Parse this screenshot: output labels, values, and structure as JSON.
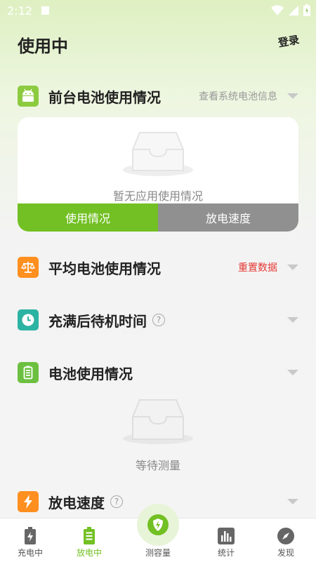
{
  "status_bar": {
    "time": "2:12"
  },
  "header": {
    "title": "使用中",
    "login_label": "登录"
  },
  "foreground_section": {
    "title": "前台电池使用情况",
    "link": "查看系统电池信息",
    "empty_text": "暂无应用使用情况",
    "tabs": [
      {
        "label": "使用情况",
        "active": true
      },
      {
        "label": "放电速度",
        "active": false
      }
    ]
  },
  "average_section": {
    "title": "平均电池使用情况",
    "reset_label": "重置数据"
  },
  "standby_section": {
    "title": "充满后待机时间",
    "help": "?"
  },
  "battery_usage_section": {
    "title": "电池使用情况",
    "empty_text": "等待测量"
  },
  "discharge_section": {
    "title": "放电速度",
    "help": "?"
  },
  "bottom_nav": {
    "items": [
      {
        "label": "充电中",
        "icon": "battery-charging-icon",
        "active": false
      },
      {
        "label": "放电中",
        "icon": "battery-discharging-icon",
        "active": true
      },
      {
        "label": "测容量",
        "icon": "shield-bolt-icon",
        "active": false
      },
      {
        "label": "统计",
        "icon": "bar-chart-icon",
        "active": false
      },
      {
        "label": "发现",
        "icon": "compass-icon",
        "active": false
      }
    ]
  },
  "colors": {
    "accent": "#72c023",
    "orange": "#ff8f1f",
    "teal": "#2bb3a3",
    "reset_red": "#e53935"
  }
}
